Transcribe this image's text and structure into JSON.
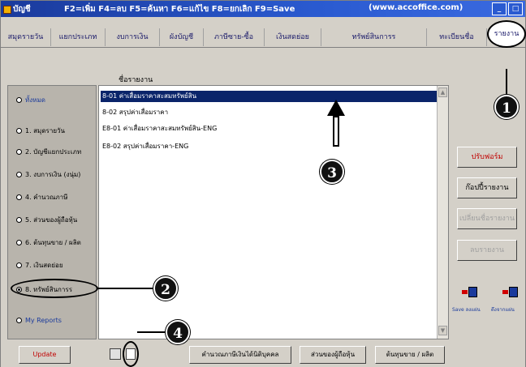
{
  "titlebar": {
    "app_name": "บัญชี",
    "shortcuts": "F2=เพิ่ม F4=ลบ F5=ค้นหา F6=แก้ไข F8=ยกเลิก F9=Save",
    "url": "(www.accoffice.com)",
    "minimize_label": "_",
    "maximize_label": "□"
  },
  "tabs": [
    {
      "label": "สมุดรายวัน"
    },
    {
      "label": "แยกประเภท"
    },
    {
      "label": "งบการเงิน"
    },
    {
      "label": "ผังบัญชี"
    },
    {
      "label": "ภาษีซาย-ซื้อ"
    },
    {
      "label": "เงินสดย่อย"
    },
    {
      "label": "ทรัพย์สินการร"
    },
    {
      "label": "ทะเบียนชื่อ"
    },
    {
      "label": "รายงาน"
    }
  ],
  "report_column_label": "ชื่อรายงาน",
  "categories": [
    {
      "label": "ทั้งหมด",
      "checked": false,
      "blue": true
    },
    {
      "label": "1. สมุดรายวัน",
      "checked": false,
      "blue": false
    },
    {
      "label": "2. บัญชีแยกประเภท",
      "checked": false,
      "blue": false
    },
    {
      "label": "3. งบการเงิน (งนุ่ม)",
      "checked": false,
      "blue": false
    },
    {
      "label": "4. คำนวณภาษี",
      "checked": false,
      "blue": false
    },
    {
      "label": "5. ส่วนของผู้ถือหุ้น",
      "checked": false,
      "blue": false
    },
    {
      "label": "6. ต้นทุนขาย / ผลิต",
      "checked": false,
      "blue": false
    },
    {
      "label": "7. เงินสดย่อย",
      "checked": false,
      "blue": false
    },
    {
      "label": "8. ทรัพย์สินการร",
      "checked": true,
      "blue": false
    },
    {
      "label": "My Reports",
      "checked": false,
      "blue": true
    }
  ],
  "reports": [
    {
      "label": "8-01 ค่าเสื่อมราคาสะสมทรัพย์สิน",
      "selected": true
    },
    {
      "label": "8-02 สรุปค่าเสื่อมราคา",
      "selected": false
    },
    {
      "label": "E8-01 ค่าเสื่อมราคาสะสมทรัพย์สิน-ENG",
      "selected": false
    },
    {
      "label": "E8-02 สรุปค่าเสื่อมราคา-ENG",
      "selected": false
    }
  ],
  "right_buttons": {
    "form_adjust": "ปรับฟอร์ม",
    "copy_report": "ก๊อปปี้รายงาน",
    "rename_report": "เปลี่ยนชื่อรายงาน",
    "delete_report": "ลบรายงาน"
  },
  "save_labels": {
    "save_to_disk": "Save ลงแผ่น",
    "load_from_disk": "ดึงจากแผ่น"
  },
  "bottom_buttons": {
    "update": "Update",
    "tax_calc": "คำนวณภาษีเงินได้นิติบุคคล",
    "shareholder": "ส่วนของผู้ถือหุ้น",
    "cost_of_sales": "ต้นทุนขาย / ผลิต"
  },
  "callouts": {
    "one": "1",
    "two": "2",
    "three": "3",
    "four": "4"
  },
  "colors": {
    "title_bar": "#2a5ad0",
    "selection": "#0a246a",
    "accent_red": "#c00000"
  }
}
